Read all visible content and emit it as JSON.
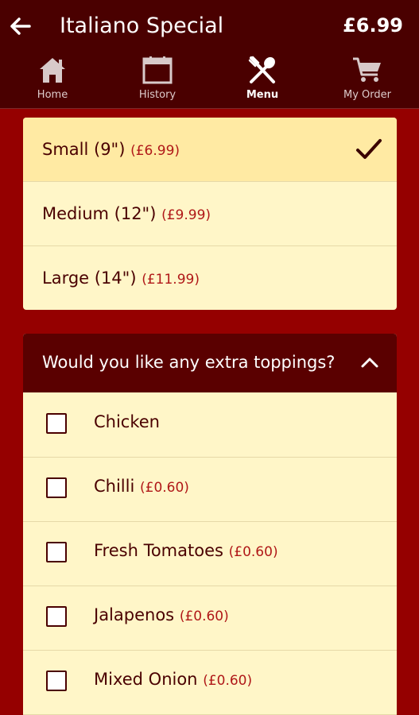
{
  "header": {
    "title": "Italiano Special",
    "price": "£6.99"
  },
  "nav": [
    {
      "label": "Home",
      "icon": "home-icon"
    },
    {
      "label": "History",
      "icon": "calendar-icon"
    },
    {
      "label": "Menu",
      "icon": "fork-spoon-icon",
      "active": true
    },
    {
      "label": "My Order",
      "icon": "cart-icon"
    }
  ],
  "sizes": [
    {
      "name": "Small (9\")",
      "price": "(£6.99)",
      "selected": true
    },
    {
      "name": "Medium (12\")",
      "price": "(£9.99)",
      "selected": false
    },
    {
      "name": "Large (14\")",
      "price": "(£11.99)",
      "selected": false
    }
  ],
  "toppings": {
    "question": "Would you like any extra toppings?",
    "items": [
      {
        "name": "Chicken",
        "price": "",
        "checked": false
      },
      {
        "name": "Chilli",
        "price": "(£0.60)",
        "checked": false
      },
      {
        "name": "Fresh Tomatoes",
        "price": "(£0.60)",
        "checked": false
      },
      {
        "name": "Jalapenos",
        "price": "(£0.60)",
        "checked": false
      },
      {
        "name": "Mixed Onion",
        "price": "(£0.60)",
        "checked": false
      }
    ]
  },
  "colors": {
    "header_bg": "#4a0000",
    "page_bg": "#950000",
    "panel_bg": "#fff6c8",
    "selected_bg": "#ffeaa3",
    "price_text": "#b01818"
  }
}
